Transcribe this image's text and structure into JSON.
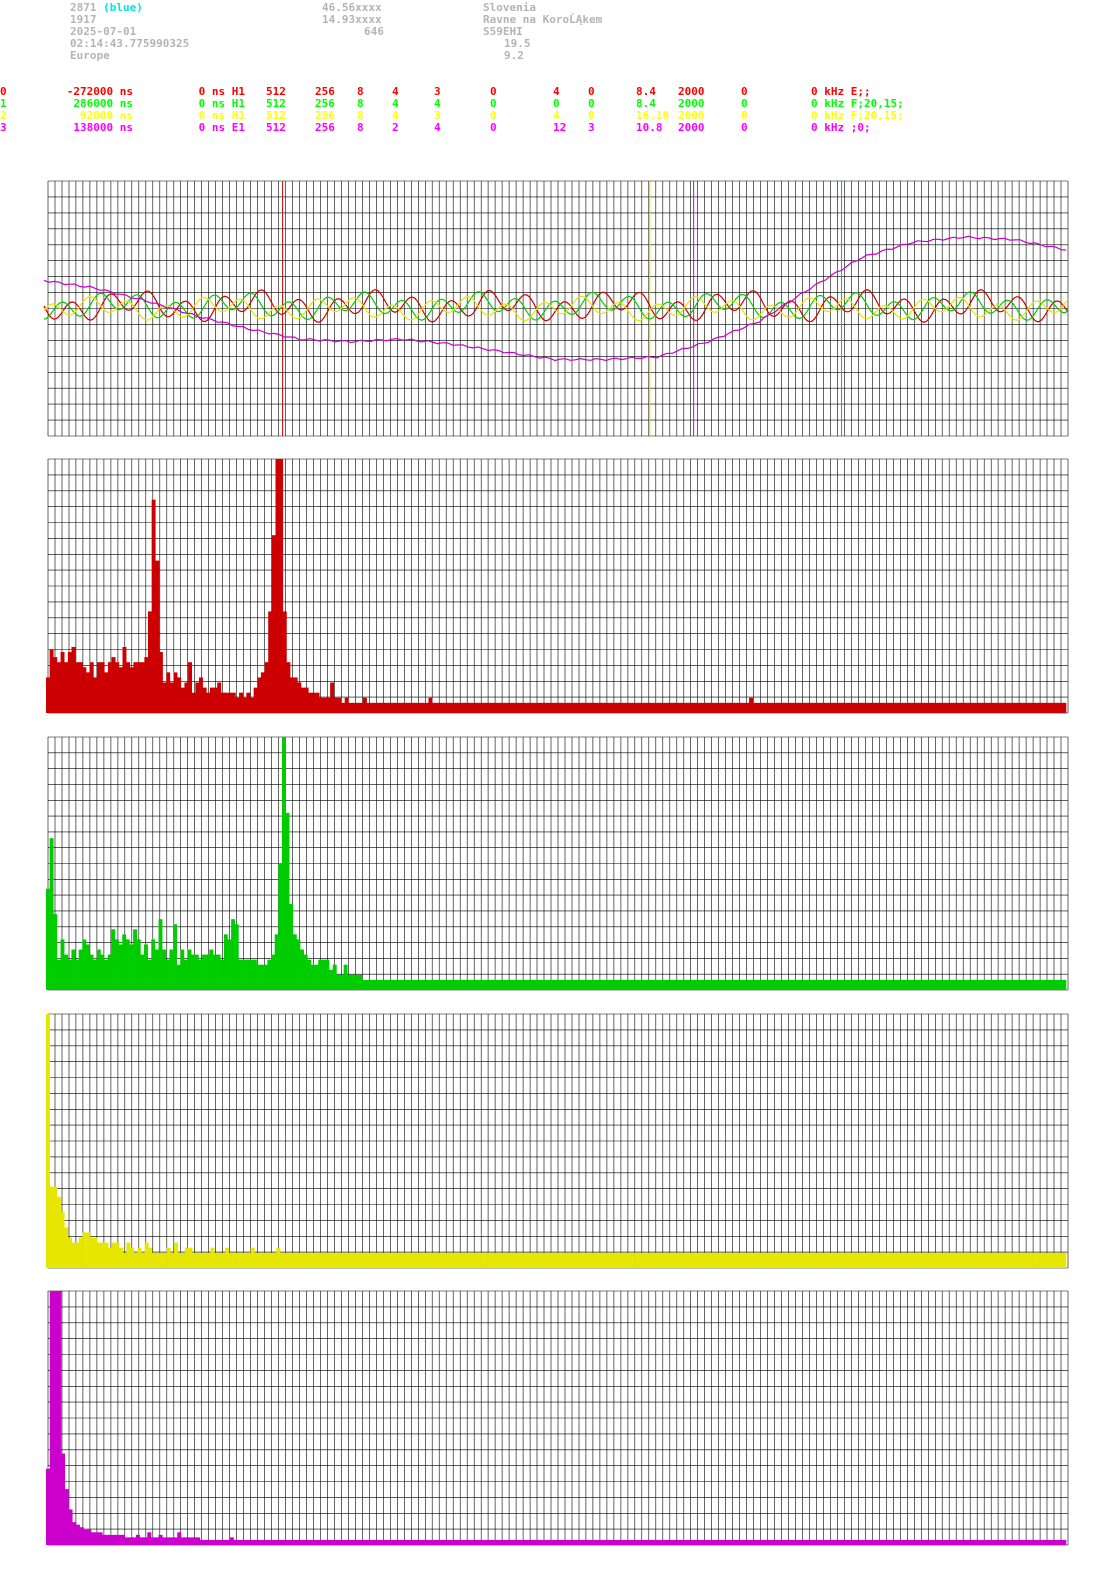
{
  "header": {
    "col1": [
      "2871",
      "1917",
      "2025-07-01",
      "02:14:43.775990325",
      "Europe"
    ],
    "col1_highlight": "(blue)",
    "col2": [
      "46.56xxxx",
      "14.93xxxx",
      "646"
    ],
    "col3": [
      "Slovenia",
      "Ravne na KoroĹĄkem",
      "S59EHI",
      "19.5",
      "9.2"
    ]
  },
  "channels": [
    {
      "id": "0",
      "color": "#ff0000",
      "cells": [
        "-272000 ns",
        "0 ns H1",
        "512",
        "256",
        "8",
        "4",
        "3",
        "0",
        "4",
        "0",
        "8.4",
        "2000",
        "0",
        "0 kHz E;;"
      ]
    },
    {
      "id": "1",
      "color": "#00ff00",
      "cells": [
        "286000 ns",
        "0 ns H1",
        "512",
        "256",
        "8",
        "4",
        "4",
        "0",
        "0",
        "0",
        "8.4",
        "2000",
        "0",
        "0 kHz F;20,15;"
      ]
    },
    {
      "id": "2",
      "color": "#ffff00",
      "cells": [
        "92000 ns",
        "0 ns H1",
        "512",
        "256",
        "8",
        "4",
        "3",
        "0",
        "4",
        "0",
        "16.10",
        "2000",
        "0",
        "0 kHz F;20,15;"
      ]
    },
    {
      "id": "3",
      "color": "#ff00ff",
      "cells": [
        "138000 ns",
        "0 ns E1",
        "512",
        "256",
        "8",
        "2",
        "4",
        "0",
        "12",
        "3",
        "10.8",
        "2000",
        "0",
        "0 kHz ;0;"
      ]
    }
  ],
  "colors": {
    "red": "#cc0000",
    "green": "#00cc00",
    "yellow": "#e6e600",
    "magenta": "#cc00cc",
    "grid": "#000000"
  },
  "chart_data": [
    {
      "type": "line",
      "series": [
        {
          "color": "red",
          "kind": "oscillation",
          "level": 0.49,
          "amp": 0.04
        },
        {
          "color": "green",
          "kind": "oscillation",
          "level": 0.49,
          "amp": 0.035
        },
        {
          "color": "yellow",
          "kind": "oscillation",
          "level": 0.5,
          "amp": 0.03
        },
        {
          "color": "magenta",
          "kind": "trend",
          "y": [
            0.39,
            0.42,
            0.47,
            0.53,
            0.58,
            0.62,
            0.63,
            0.62,
            0.64,
            0.67,
            0.7,
            0.7,
            0.69,
            0.63,
            0.55,
            0.42,
            0.3,
            0.24,
            0.22,
            0.23,
            0.27
          ]
        }
      ],
      "markers": [
        {
          "color": "red",
          "x": 0.23
        },
        {
          "color": "yellow",
          "x": 0.59
        },
        {
          "color": "magenta",
          "x": 0.633
        },
        {
          "color": "green",
          "x": 0.778
        }
      ]
    },
    {
      "type": "bar",
      "color": "red",
      "values": [
        0.14,
        0.25,
        0.22,
        0.2,
        0.24,
        0.2,
        0.24,
        0.26,
        0.2,
        0.2,
        0.18,
        0.16,
        0.2,
        0.14,
        0.2,
        0.2,
        0.16,
        0.2,
        0.22,
        0.2,
        0.18,
        0.26,
        0.2,
        0.18,
        0.2,
        0.2,
        0.2,
        0.22,
        0.4,
        0.84,
        0.6,
        0.24,
        0.12,
        0.16,
        0.12,
        0.16,
        0.14,
        0.1,
        0.12,
        0.2,
        0.08,
        0.12,
        0.14,
        0.1,
        0.08,
        0.1,
        0.1,
        0.12,
        0.08,
        0.08,
        0.08,
        0.08,
        0.06,
        0.08,
        0.06,
        0.08,
        0.06,
        0.1,
        0.14,
        0.16,
        0.2,
        0.4,
        0.7,
        1.0,
        1.0,
        0.4,
        0.2,
        0.14,
        0.14,
        0.12,
        0.1,
        0.1,
        0.08,
        0.08,
        0.08,
        0.06,
        0.06,
        0.06,
        0.12,
        0.06,
        0.06,
        0.04,
        0.06,
        0.04,
        0.04,
        0.04,
        0.04,
        0.06,
        0.04,
        0.04,
        0.04,
        0.04,
        0.04,
        0.04,
        0.04,
        0.04,
        0.04,
        0.04,
        0.04,
        0.04,
        0.04,
        0.04,
        0.04,
        0.04,
        0.04,
        0.06,
        0.04,
        0.04,
        0.04,
        0.04,
        0.04,
        0.04,
        0.04,
        0.04,
        0.04,
        0.04,
        0.04,
        0.04,
        0.04,
        0.04,
        0.04,
        0.04,
        0.04,
        0.04,
        0.04,
        0.04,
        0.04,
        0.04,
        0.04,
        0.04,
        0.04,
        0.04,
        0.04,
        0.04,
        0.04,
        0.04,
        0.04,
        0.04,
        0.04,
        0.04,
        0.04,
        0.04,
        0.04,
        0.04,
        0.04,
        0.04,
        0.04,
        0.04,
        0.04,
        0.04,
        0.04,
        0.04,
        0.04,
        0.04,
        0.04,
        0.04,
        0.04,
        0.04,
        0.04,
        0.04,
        0.04,
        0.04,
        0.04,
        0.04,
        0.04,
        0.04,
        0.04,
        0.04,
        0.04,
        0.04,
        0.04,
        0.04,
        0.04,
        0.04,
        0.04,
        0.04,
        0.04,
        0.04,
        0.04,
        0.04,
        0.04,
        0.04,
        0.04,
        0.04,
        0.04,
        0.04,
        0.04,
        0.04,
        0.04,
        0.04,
        0.04,
        0.04,
        0.04,
        0.06,
        0.04,
        0.04,
        0.04,
        0.04,
        0.04,
        0.04,
        0.04,
        0.04,
        0.04,
        0.04,
        0.04,
        0.04,
        0.04,
        0.04,
        0.04,
        0.04,
        0.04,
        0.04,
        0.04,
        0.04,
        0.04,
        0.04,
        0.04,
        0.04,
        0.04,
        0.04,
        0.04,
        0.04,
        0.04,
        0.04,
        0.04,
        0.04,
        0.04,
        0.04,
        0.04,
        0.04,
        0.04,
        0.04,
        0.04,
        0.04,
        0.04,
        0.04,
        0.04,
        0.04,
        0.04,
        0.04,
        0.04,
        0.04,
        0.04,
        0.04,
        0.04,
        0.04,
        0.04,
        0.04,
        0.04,
        0.04,
        0.04,
        0.04,
        0.04,
        0.04,
        0.04,
        0.04,
        0.04,
        0.04,
        0.04,
        0.04,
        0.04,
        0.04,
        0.04,
        0.04,
        0.04,
        0.04,
        0.04,
        0.04,
        0.04,
        0.04,
        0.04,
        0.04,
        0.04,
        0.04,
        0.04,
        0.04,
        0.04,
        0.04,
        0.04,
        0.04
      ]
    },
    {
      "type": "bar",
      "color": "green",
      "values": [
        0.4,
        0.6,
        0.3,
        0.12,
        0.2,
        0.14,
        0.12,
        0.16,
        0.12,
        0.16,
        0.2,
        0.18,
        0.14,
        0.12,
        0.16,
        0.14,
        0.12,
        0.14,
        0.24,
        0.2,
        0.18,
        0.22,
        0.2,
        0.18,
        0.24,
        0.2,
        0.14,
        0.18,
        0.12,
        0.2,
        0.16,
        0.28,
        0.16,
        0.12,
        0.16,
        0.26,
        0.1,
        0.16,
        0.12,
        0.16,
        0.14,
        0.14,
        0.12,
        0.14,
        0.14,
        0.16,
        0.14,
        0.14,
        0.12,
        0.22,
        0.2,
        0.28,
        0.26,
        0.12,
        0.12,
        0.12,
        0.12,
        0.12,
        0.1,
        0.1,
        0.1,
        0.12,
        0.14,
        0.22,
        0.5,
        1.0,
        0.7,
        0.34,
        0.22,
        0.2,
        0.16,
        0.14,
        0.12,
        0.1,
        0.1,
        0.12,
        0.12,
        0.12,
        0.08,
        0.1,
        0.06,
        0.06,
        0.1,
        0.06,
        0.06,
        0.06,
        0.06,
        0.04,
        0.04,
        0.04,
        0.04,
        0.04,
        0.04,
        0.04,
        0.04,
        0.04,
        0.04,
        0.04,
        0.04,
        0.04,
        0.04,
        0.04,
        0.04,
        0.04,
        0.04,
        0.04,
        0.04,
        0.04,
        0.04,
        0.04,
        0.04,
        0.04,
        0.04,
        0.04,
        0.04,
        0.04,
        0.04,
        0.04,
        0.04,
        0.04,
        0.04,
        0.04,
        0.04,
        0.04,
        0.04,
        0.04,
        0.04,
        0.04,
        0.04,
        0.04,
        0.04,
        0.04,
        0.04,
        0.04,
        0.04,
        0.04,
        0.04,
        0.04,
        0.04,
        0.04,
        0.04,
        0.04,
        0.04,
        0.04,
        0.04,
        0.04,
        0.04,
        0.04,
        0.04,
        0.04,
        0.04,
        0.04,
        0.04,
        0.04,
        0.04,
        0.04,
        0.04,
        0.04,
        0.04,
        0.04,
        0.04,
        0.04,
        0.04,
        0.04,
        0.04,
        0.04,
        0.04,
        0.04,
        0.04,
        0.04,
        0.04,
        0.04,
        0.04,
        0.04,
        0.04,
        0.04,
        0.04,
        0.04,
        0.04,
        0.04,
        0.04,
        0.04,
        0.04,
        0.04,
        0.04,
        0.04,
        0.04,
        0.04,
        0.04,
        0.04,
        0.04,
        0.04,
        0.04,
        0.04,
        0.04,
        0.04,
        0.04,
        0.04,
        0.04,
        0.04,
        0.04,
        0.04,
        0.04,
        0.04,
        0.04,
        0.04,
        0.04,
        0.04,
        0.04,
        0.04,
        0.04,
        0.04,
        0.04,
        0.04,
        0.04,
        0.04,
        0.04,
        0.04,
        0.04,
        0.04,
        0.04,
        0.04,
        0.04,
        0.04,
        0.04,
        0.04,
        0.04,
        0.04,
        0.04,
        0.04,
        0.04,
        0.04,
        0.04,
        0.04,
        0.04,
        0.04,
        0.04,
        0.04,
        0.04,
        0.04,
        0.04,
        0.04,
        0.04,
        0.04,
        0.04,
        0.04,
        0.04,
        0.04,
        0.04,
        0.04,
        0.04,
        0.04,
        0.04,
        0.04,
        0.04,
        0.04,
        0.04,
        0.04,
        0.04,
        0.04,
        0.04,
        0.04,
        0.04,
        0.04,
        0.04,
        0.04,
        0.04,
        0.04,
        0.04,
        0.04,
        0.04,
        0.04,
        0.04,
        0.04,
        0.04,
        0.04,
        0.04,
        0.04,
        0.04,
        0.04,
        0.04
      ]
    },
    {
      "type": "bar",
      "color": "yellow",
      "values": [
        1.0,
        0.32,
        0.32,
        0.28,
        0.22,
        0.16,
        0.12,
        0.1,
        0.1,
        0.12,
        0.14,
        0.14,
        0.12,
        0.12,
        0.1,
        0.1,
        0.1,
        0.08,
        0.1,
        0.1,
        0.08,
        0.06,
        0.1,
        0.08,
        0.06,
        0.08,
        0.06,
        0.1,
        0.08,
        0.06,
        0.06,
        0.06,
        0.06,
        0.08,
        0.06,
        0.1,
        0.06,
        0.06,
        0.08,
        0.08,
        0.06,
        0.06,
        0.06,
        0.06,
        0.06,
        0.08,
        0.06,
        0.06,
        0.06,
        0.08,
        0.06,
        0.06,
        0.06,
        0.06,
        0.06,
        0.06,
        0.08,
        0.06,
        0.06,
        0.06,
        0.06,
        0.06,
        0.06,
        0.08,
        0.06,
        0.06,
        0.06,
        0.06,
        0.06,
        0.06,
        0.06,
        0.06,
        0.06,
        0.06,
        0.06,
        0.06,
        0.06,
        0.06,
        0.06,
        0.06,
        0.06,
        0.06,
        0.06,
        0.06,
        0.06,
        0.06,
        0.06,
        0.06,
        0.06,
        0.06,
        0.06,
        0.06,
        0.06,
        0.06,
        0.06,
        0.06,
        0.06,
        0.06,
        0.06,
        0.06,
        0.06,
        0.06,
        0.06,
        0.06,
        0.06,
        0.06,
        0.06,
        0.06,
        0.06,
        0.06,
        0.06,
        0.06,
        0.06,
        0.06,
        0.06,
        0.06,
        0.06,
        0.06,
        0.06,
        0.06,
        0.06,
        0.06,
        0.06,
        0.06,
        0.06,
        0.06,
        0.06,
        0.06,
        0.06,
        0.06,
        0.06,
        0.06,
        0.06,
        0.06,
        0.06,
        0.06,
        0.06,
        0.06,
        0.06,
        0.06,
        0.06,
        0.06,
        0.06,
        0.06,
        0.06,
        0.06,
        0.06,
        0.06,
        0.06,
        0.06,
        0.06,
        0.06,
        0.06,
        0.06,
        0.06,
        0.06,
        0.06,
        0.06,
        0.06,
        0.06,
        0.06,
        0.06,
        0.06,
        0.06,
        0.06,
        0.06,
        0.06,
        0.06,
        0.06,
        0.06,
        0.06,
        0.06,
        0.06,
        0.06,
        0.06,
        0.06,
        0.06,
        0.06,
        0.06,
        0.06,
        0.06,
        0.06,
        0.06,
        0.06,
        0.06,
        0.06,
        0.06,
        0.06,
        0.06,
        0.06,
        0.06,
        0.06,
        0.06,
        0.06,
        0.06,
        0.06,
        0.06,
        0.06,
        0.06,
        0.06,
        0.06,
        0.06,
        0.06,
        0.06,
        0.06,
        0.06,
        0.06,
        0.06,
        0.06,
        0.06,
        0.06,
        0.06,
        0.06,
        0.06,
        0.06,
        0.06,
        0.06,
        0.06,
        0.06,
        0.06,
        0.06,
        0.06,
        0.06,
        0.06,
        0.06,
        0.06,
        0.06,
        0.06,
        0.06,
        0.06,
        0.06,
        0.06,
        0.06,
        0.06,
        0.06,
        0.06,
        0.06,
        0.06,
        0.06,
        0.06,
        0.06,
        0.06,
        0.06,
        0.06,
        0.06,
        0.06,
        0.06,
        0.06,
        0.06,
        0.06,
        0.06,
        0.06,
        0.06,
        0.06,
        0.06,
        0.06,
        0.06,
        0.06,
        0.06,
        0.06,
        0.06,
        0.06,
        0.06,
        0.06,
        0.06,
        0.06,
        0.06,
        0.06,
        0.06,
        0.06,
        0.06,
        0.06,
        0.06,
        0.06,
        0.06,
        0.06,
        0.06,
        0.06,
        0.06
      ]
    },
    {
      "type": "bar",
      "color": "magenta",
      "values": [
        0.3,
        1.0,
        1.0,
        1.0,
        0.36,
        0.22,
        0.14,
        0.09,
        0.08,
        0.07,
        0.06,
        0.06,
        0.05,
        0.05,
        0.05,
        0.04,
        0.04,
        0.04,
        0.04,
        0.04,
        0.04,
        0.03,
        0.03,
        0.03,
        0.04,
        0.03,
        0.03,
        0.05,
        0.03,
        0.03,
        0.04,
        0.03,
        0.03,
        0.03,
        0.03,
        0.05,
        0.03,
        0.03,
        0.03,
        0.03,
        0.03,
        0.02,
        0.02,
        0.02,
        0.02,
        0.02,
        0.02,
        0.02,
        0.02,
        0.03,
        0.02,
        0.02,
        0.02,
        0.02,
        0.02,
        0.02,
        0.02,
        0.02,
        0.02,
        0.02,
        0.02,
        0.02,
        0.02,
        0.02,
        0.02,
        0.02,
        0.02,
        0.02,
        0.02,
        0.02,
        0.02,
        0.02,
        0.02,
        0.02,
        0.02,
        0.02,
        0.02,
        0.02,
        0.02,
        0.02,
        0.02,
        0.02,
        0.02,
        0.02,
        0.02,
        0.02,
        0.02,
        0.02,
        0.02,
        0.02,
        0.02,
        0.02,
        0.02,
        0.02,
        0.02,
        0.02,
        0.02,
        0.02,
        0.02,
        0.02,
        0.02,
        0.02,
        0.02,
        0.02,
        0.02,
        0.02,
        0.02,
        0.02,
        0.02,
        0.02,
        0.02,
        0.02,
        0.02,
        0.02,
        0.02,
        0.02,
        0.02,
        0.02,
        0.02,
        0.02,
        0.02,
        0.02,
        0.02,
        0.02,
        0.02,
        0.02,
        0.02,
        0.02,
        0.02,
        0.02,
        0.02,
        0.02,
        0.02,
        0.02,
        0.02,
        0.02,
        0.02,
        0.02,
        0.02,
        0.02,
        0.02,
        0.02,
        0.02,
        0.02,
        0.02,
        0.02,
        0.02,
        0.02,
        0.02,
        0.02,
        0.02,
        0.02,
        0.02,
        0.02,
        0.02,
        0.02,
        0.02,
        0.02,
        0.02,
        0.02,
        0.02,
        0.02,
        0.02,
        0.02,
        0.02,
        0.02,
        0.02,
        0.02,
        0.02,
        0.02,
        0.02,
        0.02,
        0.02,
        0.02,
        0.02,
        0.02,
        0.02,
        0.02,
        0.02,
        0.02,
        0.02,
        0.02,
        0.02,
        0.02,
        0.02,
        0.02,
        0.02,
        0.02,
        0.02,
        0.02,
        0.02,
        0.02,
        0.02,
        0.02,
        0.02,
        0.02,
        0.02,
        0.02,
        0.02,
        0.02,
        0.02,
        0.02,
        0.02,
        0.02,
        0.02,
        0.02,
        0.02,
        0.02,
        0.02,
        0.02,
        0.02,
        0.02,
        0.02,
        0.02,
        0.02,
        0.02,
        0.02,
        0.02,
        0.02,
        0.02,
        0.02,
        0.02,
        0.02,
        0.02,
        0.02,
        0.02,
        0.02,
        0.02,
        0.02,
        0.02,
        0.02,
        0.02,
        0.02,
        0.02,
        0.02,
        0.02,
        0.02,
        0.02,
        0.02,
        0.02,
        0.02,
        0.02,
        0.02,
        0.02,
        0.02,
        0.02,
        0.02,
        0.02,
        0.02,
        0.02,
        0.02,
        0.02,
        0.02,
        0.02,
        0.02,
        0.02,
        0.02,
        0.02,
        0.02,
        0.02,
        0.02,
        0.02,
        0.02,
        0.02,
        0.02,
        0.02,
        0.02,
        0.02,
        0.02,
        0.02,
        0.02,
        0.02
      ]
    }
  ]
}
